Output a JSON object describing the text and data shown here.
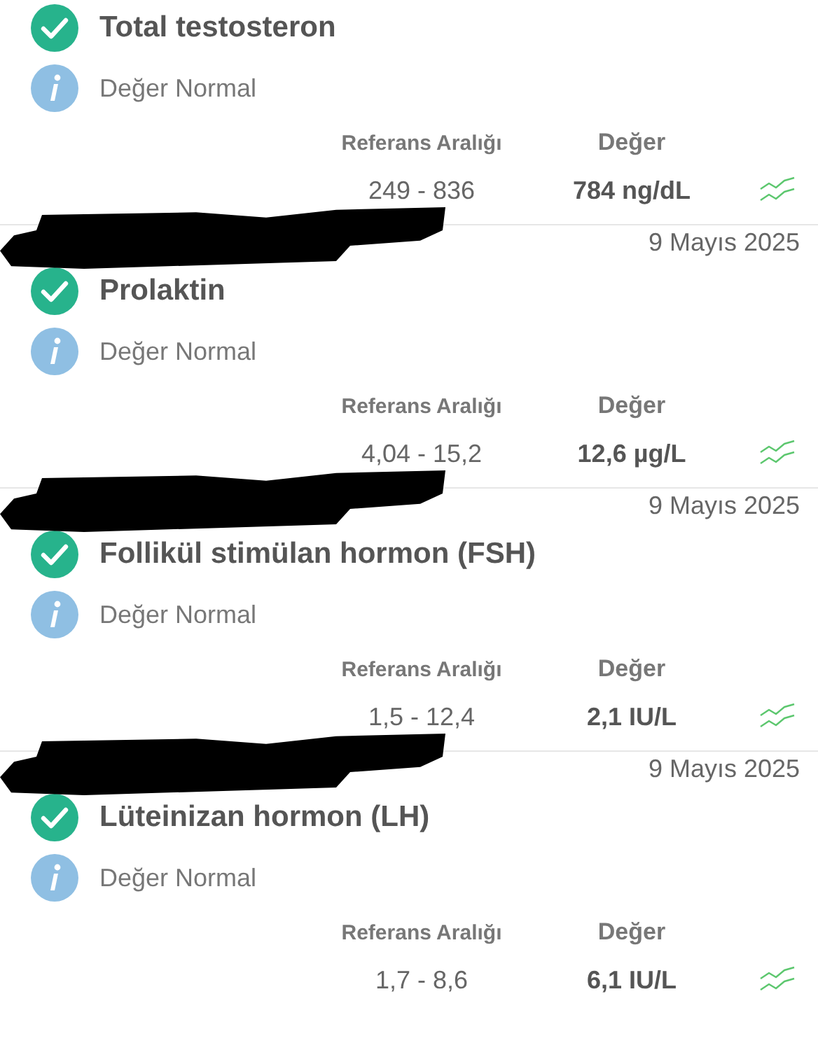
{
  "results": [
    {
      "normal": true,
      "title": "Total testosteron",
      "note": "Değer Normal",
      "range_header": "Referans Aralığı",
      "value_header": "Değer",
      "range": "249 - 836",
      "value": "784 ng/dL"
    },
    {
      "redacted": true,
      "date": "9 Mayıs 2025",
      "normal": true,
      "title": "Prolaktin",
      "note": "Değer Normal",
      "range_header": "Referans Aralığı",
      "value_header": "Değer",
      "range": "4,04 - 15,2",
      "value": "12,6 µg/L"
    },
    {
      "redacted": true,
      "date": "9 Mayıs 2025",
      "normal": true,
      "title": "Follikül stimülan hormon (FSH)",
      "note": "Değer Normal",
      "range_header": "Referans Aralığı",
      "value_header": "Değer",
      "range": "1,5 - 12,4",
      "value": "2,1 IU/L"
    },
    {
      "redacted": true,
      "date": "9 Mayıs 2025",
      "normal": true,
      "title": "Lüteinizan hormon (LH)",
      "note": "Değer Normal",
      "range_header": "Referans Aralığı",
      "value_header": "Değer",
      "range": "1,7 - 8,6",
      "value": "6,1 IU/L"
    }
  ]
}
